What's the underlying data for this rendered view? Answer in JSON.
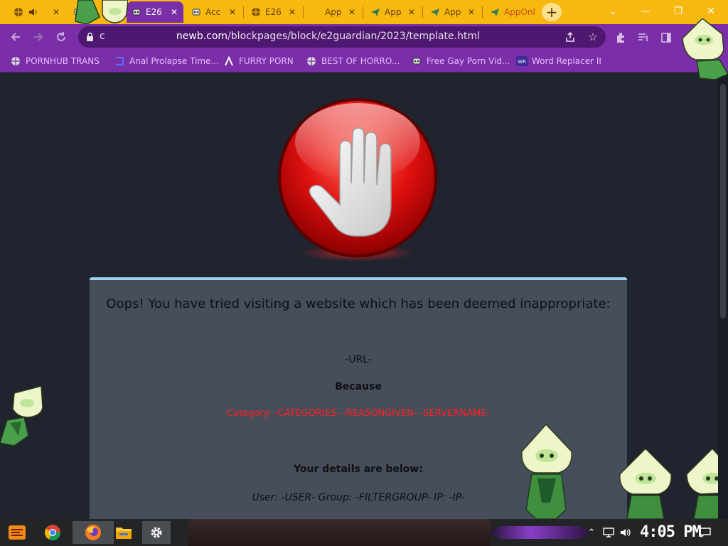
{
  "browser": {
    "tabs": [
      {
        "title": "",
        "icon": "globe-icon",
        "audio": true,
        "active": false
      },
      {
        "title": "",
        "icon": "extension-icon",
        "active": false
      },
      {
        "title": "E26",
        "icon": "extension-icon",
        "active": true
      },
      {
        "title": "Acc",
        "icon": "extension-icon",
        "active": false
      },
      {
        "title": "E26",
        "icon": "globe-icon",
        "active": false
      },
      {
        "title": "App",
        "icon": "blank-icon",
        "active": false
      },
      {
        "title": "App",
        "icon": "send-icon",
        "active": false
      },
      {
        "title": "App",
        "icon": "send-icon",
        "active": false
      },
      {
        "title": "AppOnl",
        "icon": "send-icon",
        "active": false
      }
    ],
    "new_tab_label": "+",
    "window_controls": {
      "minimize": "⌄",
      "restore": "—",
      "maximize": "❐",
      "close": "✕"
    },
    "address": {
      "prefix": "c",
      "host": "newb.com",
      "path": "/blockpages/block/e2guardian/2023/template.html"
    },
    "bookmarks": [
      {
        "label": "PORNHUB TRANS",
        "icon": "globe-icon"
      },
      {
        "label": "Anal Prolapse Time...",
        "icon": "bracket-icon"
      },
      {
        "label": "FURRY PORN",
        "icon": "lambda-icon"
      },
      {
        "label": "BEST OF HORRO...",
        "icon": "globe-icon"
      },
      {
        "label": "Free Gay Porn Vid...",
        "icon": "extension-icon"
      },
      {
        "label": "Word Replacer II",
        "icon": "wr-icon"
      }
    ]
  },
  "blockpage": {
    "heading": "Oops! You have tried visiting a website which has been deemed inappropriate:",
    "url_placeholder": "-URL-",
    "because": "Because",
    "reason_line": "Category: -CATEGORIES-   -REASONGIVEN-  -SERVERNAME-",
    "details_heading": "Your details are below:",
    "user_line": "User: -USER-    Group: -FILTERGROUP-    IP: -IP-"
  },
  "taskbar": {
    "clock": "4:05 PM",
    "items": [
      "start-icon",
      "chrome-icon",
      "firefox-icon",
      "folder-icon",
      "settings-icon"
    ]
  },
  "colors": {
    "tab_strip": "#f7b90f",
    "toolbar": "#7a2ea8",
    "page_bg": "#20242e",
    "panel_bg": "#464d5b",
    "panel_border": "#9ad0f0",
    "reason_text": "#ff2020"
  }
}
